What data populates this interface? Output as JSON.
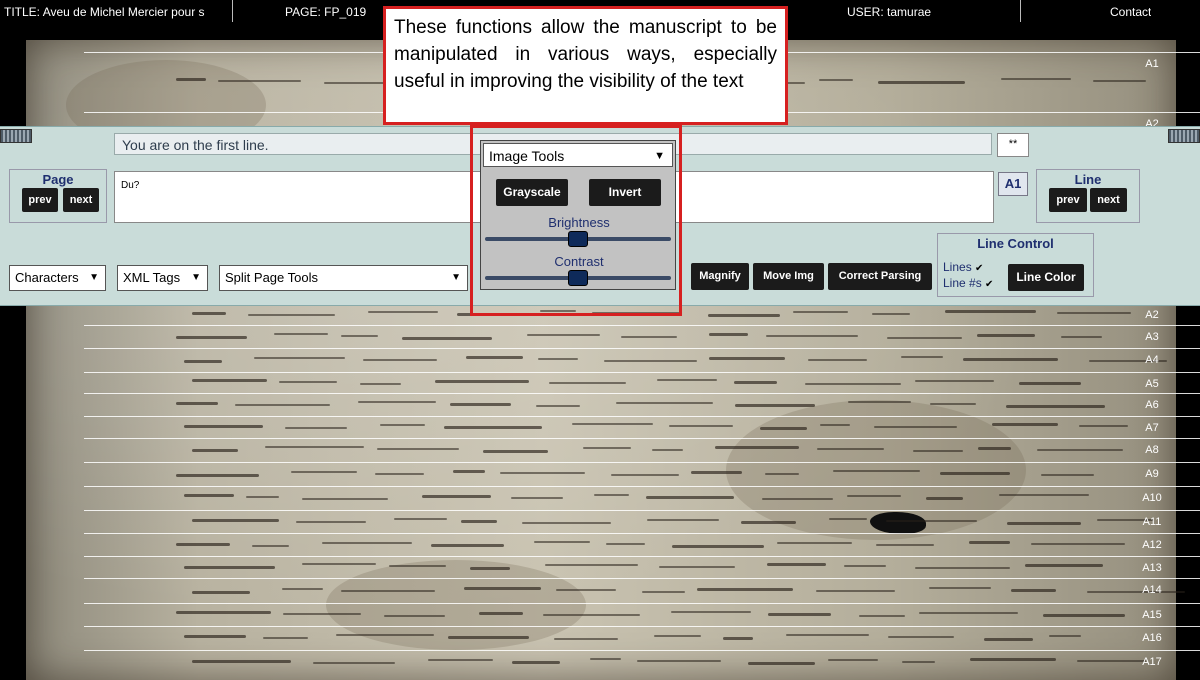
{
  "topbar": {
    "title_label": "TITLE:",
    "title_value": "Aveu de Michel Mercier pour s",
    "page_label": "PAGE:",
    "page_value": "FP_019",
    "user_label": "USER:",
    "user_value": "tamurae",
    "contact": "Contact"
  },
  "callout": {
    "text": "These functions allow the manuscript to be manipulated in various ways, especially useful in improving the visibility of the text"
  },
  "panel": {
    "status": "You are on the first line.",
    "small_button": "**",
    "page_nav": {
      "title": "Page",
      "prev": "prev",
      "next": "next"
    },
    "line_nav": {
      "title": "Line",
      "prev": "prev",
      "next": "next"
    },
    "transcription": "Du?",
    "line_id": "A1",
    "selects": {
      "characters": "Characters",
      "xml_tags": "XML Tags",
      "split_page": "Split Page Tools"
    },
    "image_tools": {
      "label": "Image Tools",
      "grayscale": "Grayscale",
      "invert": "Invert",
      "brightness": "Brightness",
      "contrast": "Contrast",
      "brightness_level": 0.5,
      "contrast_level": 0.5
    },
    "buttons": {
      "magnify": "Magnify",
      "move_img": "Move Img",
      "correct_parsing": "Correct Parsing"
    },
    "line_control": {
      "title": "Line Control",
      "lines": "Lines",
      "line_numbers": "Line #s",
      "line_color": "Line Color"
    }
  },
  "manuscript": {
    "line_labels": [
      "A1",
      "A2",
      "A2",
      "A3",
      "A4",
      "A5",
      "A6",
      "A7",
      "A8",
      "A9",
      "A10",
      "A11",
      "A12",
      "A13",
      "A14",
      "A15",
      "A16",
      "A17"
    ]
  }
}
